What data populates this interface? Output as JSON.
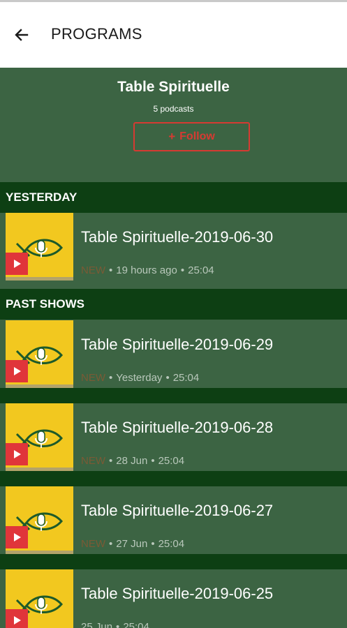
{
  "appbar": {
    "title": "PROGRAMS"
  },
  "program": {
    "title": "Table Spirituelle",
    "count": "5 podcasts",
    "follow_label": "Follow",
    "follow_icon": "+"
  },
  "sections": {
    "yesterday": "YESTERDAY",
    "past": "PAST SHOWS"
  },
  "episodes": [
    {
      "title": "Table Spirituelle-2019-06-30",
      "badge": "NEW",
      "when": "19 hours ago",
      "duration": "25:04"
    },
    {
      "title": "Table Spirituelle-2019-06-29",
      "badge": "NEW",
      "when": "Yesterday",
      "duration": "25:04"
    },
    {
      "title": "Table Spirituelle-2019-06-28",
      "badge": "NEW",
      "when": "28 Jun",
      "duration": "25:04"
    },
    {
      "title": "Table Spirituelle-2019-06-27",
      "badge": "NEW",
      "when": "27 Jun",
      "duration": "25:04"
    },
    {
      "title": "Table Spirituelle-2019-06-25",
      "badge": "",
      "when": "25 Jun",
      "duration": "25:04"
    }
  ],
  "separator": "•",
  "colors": {
    "background": "#3c6443",
    "section": "#0d3f13",
    "accent": "#d63a32",
    "thumbnail": "#f2c81f"
  },
  "icons": {
    "back": "arrow-left-icon",
    "play": "play-icon",
    "logo": "fish-microphone-icon"
  }
}
